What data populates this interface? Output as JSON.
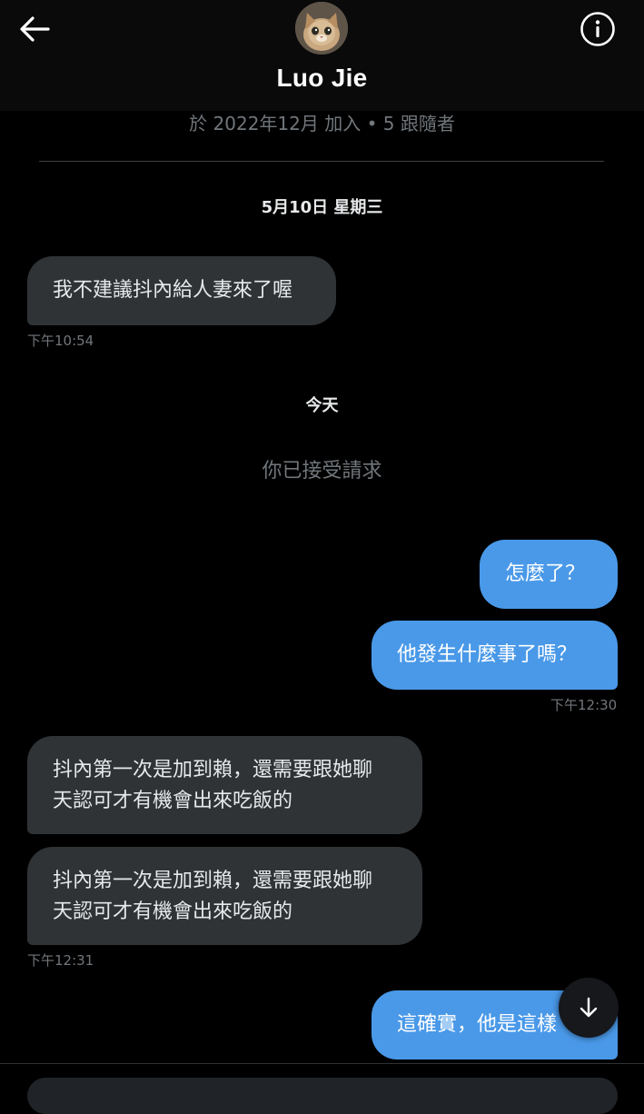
{
  "header": {
    "title": "Luo Jie",
    "join_info": "於 2022年12月 加入 • 5 跟隨者",
    "back_icon": "arrow-left-icon",
    "info_icon": "info-circle-icon"
  },
  "conversation": {
    "date_1": "5月10日 星期三",
    "date_2": "今天",
    "system_message": "你已接受請求",
    "messages": [
      {
        "direction": "incoming",
        "text": "我不建議抖內給人妻來了喔"
      },
      {
        "direction": "outgoing",
        "text": "怎麼了？"
      },
      {
        "direction": "outgoing",
        "text": "他發生什麼事了嗎？"
      },
      {
        "direction": "incoming",
        "line1": "抖內第一次是加到賴，還需要跟她聊",
        "line2": "天認可才有機會出來吃飯的"
      },
      {
        "direction": "incoming",
        "line1": "抖內第一次是加到賴，還需要跟她聊",
        "line2": "天認可才有機會出來吃飯的"
      },
      {
        "direction": "outgoing",
        "text": "這確實，他是這樣"
      }
    ],
    "times": {
      "t1": "下午10:54",
      "t2": "下午12:30",
      "t3": "下午12:31"
    }
  },
  "controls": {
    "scroll_down_icon": "arrow-down-icon"
  },
  "colors": {
    "background": "#000000",
    "outgoing_bubble": "#4a99e9",
    "incoming_bubble": "#2f3336",
    "muted_text": "#71767b"
  }
}
